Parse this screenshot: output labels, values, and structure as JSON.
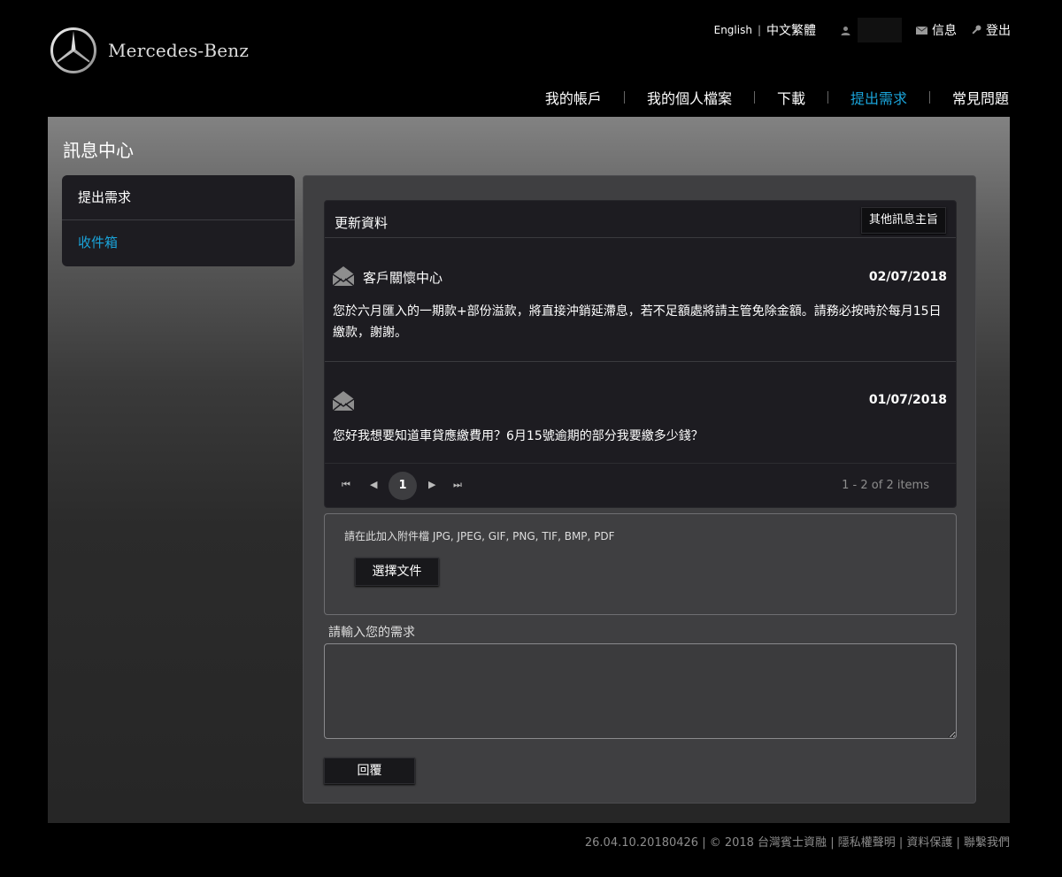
{
  "brand": {
    "name": "Mercedes-Benz",
    "logo_icon": "mercedes-star-icon"
  },
  "utility": {
    "lang_en": "English",
    "lang_sep": "|",
    "lang_zh": "中文繁體",
    "messages": "信息",
    "logout": "登出"
  },
  "nav": {
    "items": [
      {
        "label": "我的帳戶",
        "active": false
      },
      {
        "label": "我的個人檔案",
        "active": false
      },
      {
        "label": "下載",
        "active": false
      },
      {
        "label": "提出需求",
        "active": true
      },
      {
        "label": "常見問題",
        "active": false
      }
    ]
  },
  "page": {
    "title": "訊息中心"
  },
  "sidebar": {
    "items": [
      {
        "label": "提出需求",
        "active": false
      },
      {
        "label": "收件箱",
        "active": true
      }
    ]
  },
  "messages": {
    "title": "更新資料",
    "other_topics": "其他訊息主旨",
    "items": [
      {
        "sender": "客戶關懷中心",
        "date": "02/07/2018",
        "body": "您於六月匯入的一期款+部份溢款，將直接沖銷延滯息，若不足額處將請主管免除金額。請務必按時於每月15日繳款，謝謝。"
      },
      {
        "sender": "",
        "date": "01/07/2018",
        "body": "您好我想要知道車貸應繳費用？6月15號逾期的部分我要繳多少錢？"
      }
    ],
    "pager": {
      "first": "⏮",
      "prev": "◀",
      "current": "1",
      "next": "▶",
      "last": "⏭",
      "info": "1 - 2 of 2 items"
    }
  },
  "attach": {
    "hint": "請在此加入附件檔 JPG, JPEG, GIF, PNG, TIF, BMP, PDF",
    "choose_label": "選擇文件"
  },
  "request": {
    "label": "請輸入您的需求",
    "value": "",
    "reply_label": "回覆"
  },
  "footer": {
    "text": "26.04.10.20180426 | © 2018 台灣賓士資融 | 隱私權聲明 | 資料保護 | 聯繫我們"
  },
  "colors": {
    "accent": "#1aa3d9",
    "panel": "#3f3f41",
    "box": "#1d1c21"
  }
}
